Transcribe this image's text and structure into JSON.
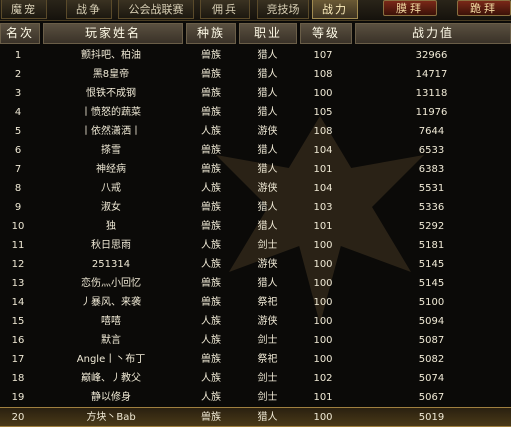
{
  "tabs": [
    {
      "label": "魔宠",
      "active": false
    },
    {
      "label": "战争",
      "active": false
    },
    {
      "label": "公会战联赛",
      "active": false
    },
    {
      "label": "佣兵",
      "active": false
    },
    {
      "label": "竞技场",
      "active": false
    },
    {
      "label": "战力",
      "active": true
    }
  ],
  "actions": {
    "worship": "膜拜",
    "kneel": "跪拜"
  },
  "columns": {
    "rank": "名次",
    "name": "玩家姓名",
    "race": "种族",
    "job": "职业",
    "level": "等级",
    "power": "战力值"
  },
  "rows": [
    {
      "rank": "1",
      "name": "颤抖吧、柏油",
      "race": "兽族",
      "job": "猎人",
      "level": "107",
      "power": "32966"
    },
    {
      "rank": "2",
      "name": "黑8皇帝",
      "race": "兽族",
      "job": "猎人",
      "level": "108",
      "power": "14717"
    },
    {
      "rank": "3",
      "name": "恨铁不成钢",
      "race": "兽族",
      "job": "猎人",
      "level": "100",
      "power": "13118"
    },
    {
      "rank": "4",
      "name": "丨愤怒的蔬菜",
      "race": "兽族",
      "job": "猎人",
      "level": "105",
      "power": "11976"
    },
    {
      "rank": "5",
      "name": "丨依然潇洒丨",
      "race": "人族",
      "job": "游侠",
      "level": "108",
      "power": "7644"
    },
    {
      "rank": "6",
      "name": "搽雪",
      "race": "兽族",
      "job": "猎人",
      "level": "104",
      "power": "6533"
    },
    {
      "rank": "7",
      "name": "神经病",
      "race": "兽族",
      "job": "猎人",
      "level": "101",
      "power": "6383"
    },
    {
      "rank": "8",
      "name": "八戒",
      "race": "人族",
      "job": "游侠",
      "level": "104",
      "power": "5531"
    },
    {
      "rank": "9",
      "name": "淑女",
      "race": "兽族",
      "job": "猎人",
      "level": "103",
      "power": "5336"
    },
    {
      "rank": "10",
      "name": "独",
      "race": "兽族",
      "job": "猎人",
      "level": "101",
      "power": "5292"
    },
    {
      "rank": "11",
      "name": "秋日思雨",
      "race": "人族",
      "job": "剑士",
      "level": "100",
      "power": "5181"
    },
    {
      "rank": "12",
      "name": "251314",
      "race": "人族",
      "job": "游侠",
      "level": "100",
      "power": "5145"
    },
    {
      "rank": "13",
      "name": "恋伤灬小回忆",
      "race": "兽族",
      "job": "猎人",
      "level": "100",
      "power": "5145"
    },
    {
      "rank": "14",
      "name": "丿暴风、来袭",
      "race": "兽族",
      "job": "祭祀",
      "level": "100",
      "power": "5100"
    },
    {
      "rank": "15",
      "name": "嘻嘻",
      "race": "人族",
      "job": "游侠",
      "level": "100",
      "power": "5094"
    },
    {
      "rank": "16",
      "name": "默言",
      "race": "人族",
      "job": "剑士",
      "level": "100",
      "power": "5087"
    },
    {
      "rank": "17",
      "name": "Angle丨丶布丁",
      "race": "兽族",
      "job": "祭祀",
      "level": "100",
      "power": "5082"
    },
    {
      "rank": "18",
      "name": "巅峰、丿教父",
      "race": "人族",
      "job": "剑士",
      "level": "102",
      "power": "5074"
    },
    {
      "rank": "19",
      "name": "静以修身",
      "race": "人族",
      "job": "剑士",
      "level": "101",
      "power": "5067"
    },
    {
      "rank": "20",
      "name": "方块丶Bab",
      "race": "兽族",
      "job": "猎人",
      "level": "100",
      "power": "5019"
    }
  ],
  "selected_row": "20"
}
